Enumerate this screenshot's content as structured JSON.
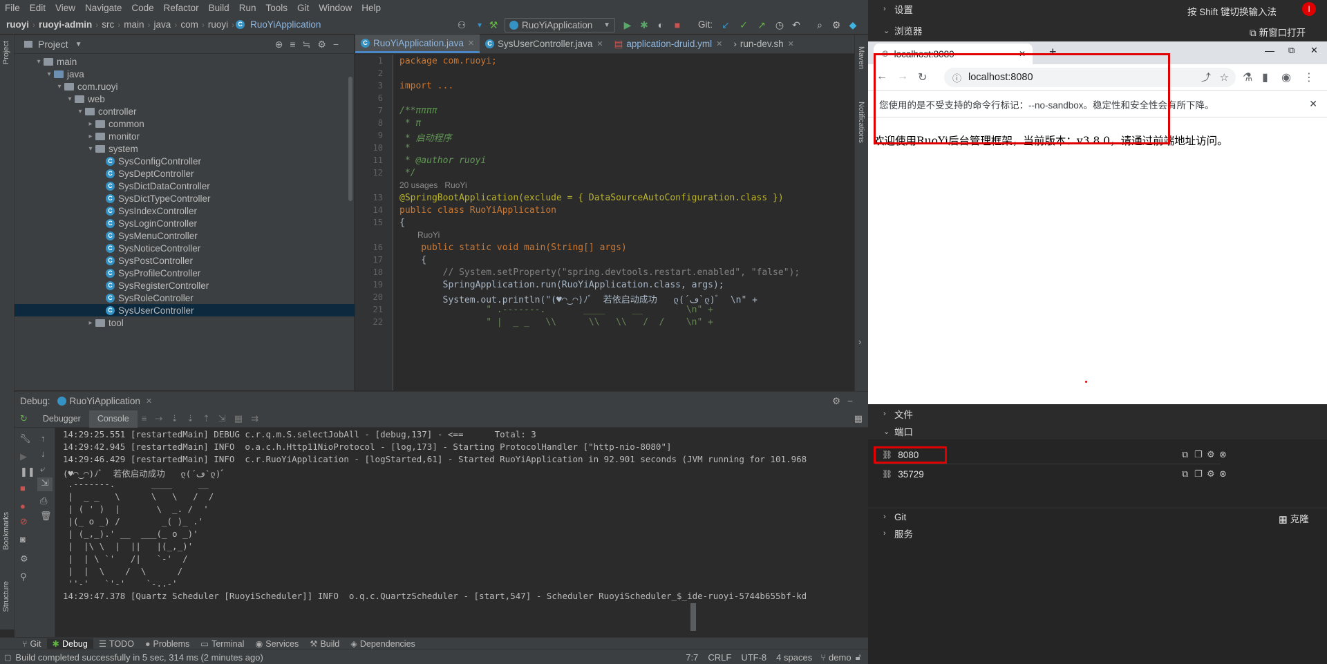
{
  "menu": [
    "File",
    "Edit",
    "View",
    "Navigate",
    "Code",
    "Refactor",
    "Build",
    "Run",
    "Tools",
    "Git",
    "Window",
    "Help"
  ],
  "breadcrumb": [
    "ruoyi",
    "ruoyi-admin",
    "src",
    "main",
    "java",
    "com",
    "ruoyi",
    "RuoYiApplication"
  ],
  "run_config": "RuoYiApplication",
  "git_label": "Git:",
  "project": {
    "title": "Project",
    "tree": [
      {
        "label": "main",
        "indent": 2,
        "type": "folder",
        "arrow": "v"
      },
      {
        "label": "java",
        "indent": 3,
        "type": "folder-blue",
        "arrow": "v"
      },
      {
        "label": "com.ruoyi",
        "indent": 4,
        "type": "folder",
        "arrow": "v"
      },
      {
        "label": "web",
        "indent": 5,
        "type": "folder",
        "arrow": "v"
      },
      {
        "label": "controller",
        "indent": 6,
        "type": "folder",
        "arrow": "v"
      },
      {
        "label": "common",
        "indent": 7,
        "type": "folder",
        "arrow": ">"
      },
      {
        "label": "monitor",
        "indent": 7,
        "type": "folder",
        "arrow": ">"
      },
      {
        "label": "system",
        "indent": 7,
        "type": "folder",
        "arrow": "v"
      },
      {
        "label": "SysConfigController",
        "indent": 8,
        "type": "class"
      },
      {
        "label": "SysDeptController",
        "indent": 8,
        "type": "class"
      },
      {
        "label": "SysDictDataController",
        "indent": 8,
        "type": "class"
      },
      {
        "label": "SysDictTypeController",
        "indent": 8,
        "type": "class"
      },
      {
        "label": "SysIndexController",
        "indent": 8,
        "type": "class"
      },
      {
        "label": "SysLoginController",
        "indent": 8,
        "type": "class"
      },
      {
        "label": "SysMenuController",
        "indent": 8,
        "type": "class"
      },
      {
        "label": "SysNoticeController",
        "indent": 8,
        "type": "class"
      },
      {
        "label": "SysPostController",
        "indent": 8,
        "type": "class"
      },
      {
        "label": "SysProfileController",
        "indent": 8,
        "type": "class"
      },
      {
        "label": "SysRegisterController",
        "indent": 8,
        "type": "class"
      },
      {
        "label": "SysRoleController",
        "indent": 8,
        "type": "class"
      },
      {
        "label": "SysUserController",
        "indent": 8,
        "type": "class",
        "selected": true
      },
      {
        "label": "tool",
        "indent": 7,
        "type": "folder",
        "arrow": ">"
      }
    ]
  },
  "editor_tabs": [
    {
      "label": "RuoYiApplication.java",
      "active": true
    },
    {
      "label": "SysUserController.java"
    },
    {
      "label": "application-druid.yml"
    },
    {
      "label": "run-dev.sh"
    }
  ],
  "code": [
    {
      "n": "1",
      "t": "package com.ruoyi;"
    },
    {
      "n": "2",
      "t": ""
    },
    {
      "n": "3",
      "t": "import ..."
    },
    {
      "n": "6",
      "t": ""
    },
    {
      "n": "7",
      "t": "/**ππππ"
    },
    {
      "n": "8",
      "t": " * π"
    },
    {
      "n": "9",
      "t": " * 启动程序"
    },
    {
      "n": "10",
      "t": " *"
    },
    {
      "n": "11",
      "t": " * @author ruoyi"
    },
    {
      "n": "12",
      "t": " */"
    },
    {
      "n": "",
      "t": "20 usages   RuoYi"
    },
    {
      "n": "13",
      "t": "@SpringBootApplication(exclude = { DataSourceAutoConfiguration.class })"
    },
    {
      "n": "14",
      "t": "public class RuoYiApplication"
    },
    {
      "n": "15",
      "t": "{"
    },
    {
      "n": "",
      "t": "RuoYi"
    },
    {
      "n": "16",
      "t": "    public static void main(String[] args)"
    },
    {
      "n": "17",
      "t": "    {"
    },
    {
      "n": "18",
      "t": "        // System.setProperty(\"spring.devtools.restart.enabled\", \"false\");"
    },
    {
      "n": "19",
      "t": "        SpringApplication.run(RuoYiApplication.class, args);"
    },
    {
      "n": "20",
      "t": "        System.out.println(\"(♥◠‿◠)ﾉﾞ  若依启动成功   ლ(´ڡ`ლ)ﾞ  \\n\" +"
    },
    {
      "n": "21",
      "t": "                \" .-------.       ____     __        \\n\" +"
    },
    {
      "n": "22",
      "t": "                \" |  _ _   \\\\      \\\\   \\\\   /  /    \\n\" +"
    }
  ],
  "debug": {
    "label": "Debug:",
    "config": "RuoYiApplication",
    "tabs": [
      "Debugger",
      "Console"
    ],
    "console": [
      "14:29:25.551 [restartedMain] DEBUG c.r.q.m.S.selectJobAll - [debug,137] - <==      Total: 3",
      "14:29:42.945 [restartedMain] INFO  o.a.c.h.Http11NioProtocol - [log,173] - Starting ProtocolHandler [\"http-nio-8080\"]",
      "14:29:46.429 [restartedMain] INFO  c.r.RuoYiApplication - [logStarted,61] - Started RuoYiApplication in 92.901 seconds (JVM running for 101.968",
      "(♥◠‿◠)ﾉﾞ  若依启动成功   ლ(´ڡ`ლ)ﾞ",
      " .-------.       ____     __",
      " |  _ _   \\      \\   \\   /  /",
      " | ( ' )  |       \\  _. /  '",
      " |(_ o _) /        _( )_ .'",
      " | (_,_).' __  ___(_ o _)'",
      " |  |\\ \\  |  ||   |(_,_)'",
      " |  | \\ `'   /|   `-'  /",
      " |  |  \\    /  \\      /",
      " ''-'   `'-'    `-..-'",
      "14:29:47.378 [Quartz Scheduler [RuoyiScheduler]] INFO  o.q.c.QuartzScheduler - [start,547] - Scheduler RuoyiScheduler_$_ide-ruoyi-5744b655bf-kd"
    ]
  },
  "bottom_tabs": [
    {
      "label": "Git"
    },
    {
      "label": "Debug",
      "active": true
    },
    {
      "label": "TODO"
    },
    {
      "label": "Problems"
    },
    {
      "label": "Terminal"
    },
    {
      "label": "Services"
    },
    {
      "label": "Build"
    },
    {
      "label": "Dependencies"
    }
  ],
  "status": {
    "message": "Build completed successfully in 5 sec, 314 ms (2 minutes ago)",
    "position": "7:7",
    "line_sep": "CRLF",
    "encoding": "UTF-8",
    "indent": "4 spaces",
    "branch": "demo"
  },
  "side_tools": [
    "Project",
    "Bookmarks",
    "Structure"
  ],
  "right_tools": [
    "Maven",
    "Notifications"
  ],
  "panel": {
    "settings": "设置",
    "ime_hint": "按 Shift 键切换输入法",
    "avatar": "I",
    "browser_section": "浏览器",
    "new_window": "新窗口打开",
    "files": "文件",
    "ports": "端口",
    "git": "Git",
    "clone": "克隆",
    "services": "服务",
    "port_list": [
      "8080",
      "35729"
    ]
  },
  "browser": {
    "tab_title": "localhost:8080",
    "address": "localhost:8080",
    "warning": "您使用的是不受支持的命令行标记：--no-sandbox。稳定性和安全性会有所下降。",
    "content": "欢迎使用RuoYi后台管理框架，当前版本：v3.8.0，请通过前端地址访问。"
  },
  "colors": {
    "accent": "#4a88c7",
    "highlight_box": "#e00000",
    "selection": "#0d293e"
  }
}
